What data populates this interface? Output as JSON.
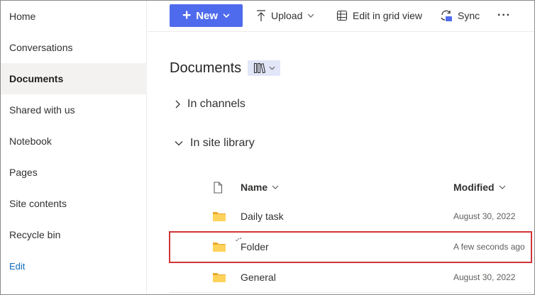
{
  "sidebar": {
    "items": [
      {
        "label": "Home"
      },
      {
        "label": "Conversations"
      },
      {
        "label": "Documents",
        "active": true
      },
      {
        "label": "Shared with us"
      },
      {
        "label": "Notebook"
      },
      {
        "label": "Pages"
      },
      {
        "label": "Site contents"
      },
      {
        "label": "Recycle bin"
      }
    ],
    "edit_label": "Edit"
  },
  "toolbar": {
    "new_label": "New",
    "upload_label": "Upload",
    "grid_label": "Edit in grid view",
    "sync_label": "Sync",
    "more_label": "···"
  },
  "page": {
    "title": "Documents",
    "sections": {
      "channels": "In channels",
      "site_library": "In site library"
    }
  },
  "table": {
    "columns": {
      "name": "Name",
      "modified": "Modified"
    },
    "rows": [
      {
        "name": "Daily task",
        "modified": "August 30, 2022"
      },
      {
        "name": "Folder",
        "modified": "A few seconds ago"
      },
      {
        "name": "General",
        "modified": "August 30, 2022"
      }
    ]
  },
  "colors": {
    "accent": "#4f6bed",
    "highlight_border": "#d13438",
    "folder": "#ffd35b",
    "active_nav_bg": "#f3f2f1"
  },
  "icons": {
    "upload": "arrow-up-icon",
    "grid": "grid-table-icon",
    "sync": "sync-icon",
    "more": "ellipsis-icon",
    "file_type": "document-icon",
    "folder": "folder-icon"
  }
}
